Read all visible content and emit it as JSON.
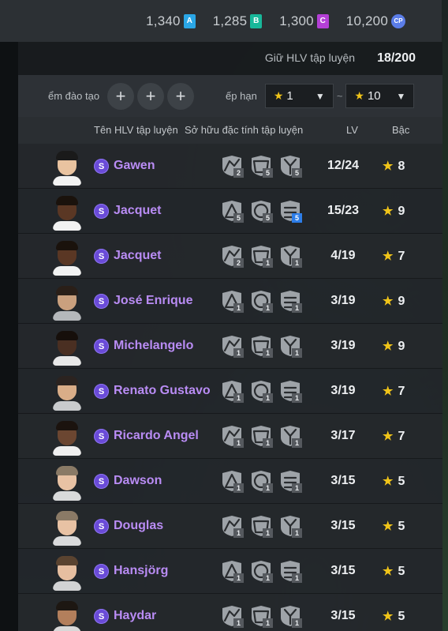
{
  "currencies": [
    {
      "value": "1,340",
      "icon": "A",
      "color": "#2aa6e6",
      "icon_name": "a-currency-icon"
    },
    {
      "value": "1,285",
      "icon": "B",
      "color": "#18b89a",
      "icon_name": "b-currency-icon"
    },
    {
      "value": "1,300",
      "icon": "C",
      "color": "#b43fd6",
      "icon_name": "c-currency-icon"
    },
    {
      "value": "10,200",
      "icon": "CP",
      "color": "#5b7de8",
      "icon_name": "cp-currency-icon"
    }
  ],
  "capacity": {
    "label": "Giữ HLV tập luyện",
    "value": "18/200"
  },
  "filters": {
    "training_label": "ểm đào tạo",
    "plus": "+",
    "rank_label": "ếp hạn",
    "rank_min": "1",
    "rank_max": "10",
    "tilde": "~",
    "star": "★",
    "chevron": "▼"
  },
  "columns": {
    "name": "Tên HLV tập luyện",
    "traits": "Sở hữu đặc tính tập luyện",
    "lv": "LV",
    "rank": "Bậc"
  },
  "badge_letter": "S",
  "rows": [
    {
      "name": "Gawen",
      "lv": "12/24",
      "rank": "8",
      "traits": [
        "2",
        "5",
        "5"
      ],
      "skin": "#e9c3a0",
      "hair": "#1a1a1a",
      "shirt": "#f2f2f2"
    },
    {
      "name": "Jacquet",
      "lv": "15/23",
      "rank": "9",
      "traits": [
        "5",
        "5",
        "5"
      ],
      "skin": "#5a3724",
      "hair": "#1a120c",
      "shirt": "#f2f2f2"
    },
    {
      "name": "Jacquet",
      "lv": "4/19",
      "rank": "7",
      "traits": [
        "2",
        "1",
        "1"
      ],
      "skin": "#5a3724",
      "hair": "#1a120c",
      "shirt": "#f2f2f2"
    },
    {
      "name": "José Enrique",
      "lv": "3/19",
      "rank": "9",
      "traits": [
        "1",
        "1",
        "1"
      ],
      "skin": "#caa07e",
      "hair": "#2a1f18",
      "shirt": "#b5b8bb"
    },
    {
      "name": "Michelangelo",
      "lv": "3/19",
      "rank": "9",
      "traits": [
        "1",
        "1",
        "1"
      ],
      "skin": "#4a2f22",
      "hair": "#160f0b",
      "shirt": "#e8e8e8"
    },
    {
      "name": "Renato Gustavo",
      "lv": "3/19",
      "rank": "7",
      "traits": [
        "1",
        "1",
        "1"
      ],
      "skin": "#d9ad88",
      "hair": "#2b2320",
      "shirt": "#c9cbcd"
    },
    {
      "name": "Ricardo Angel",
      "lv": "3/17",
      "rank": "7",
      "traits": [
        "1",
        "1",
        "1"
      ],
      "skin": "#6b4631",
      "hair": "#1b130e",
      "shirt": "#efefef"
    },
    {
      "name": "Dawson",
      "lv": "3/15",
      "rank": "5",
      "traits": [
        "1",
        "1",
        "1"
      ],
      "skin": "#e8c2a4",
      "hair": "#8a7a66",
      "shirt": "#d9dadb"
    },
    {
      "name": "Douglas",
      "lv": "3/15",
      "rank": "5",
      "traits": [
        "1",
        "1",
        "1"
      ],
      "skin": "#e8c2a4",
      "hair": "#8a7a66",
      "shirt": "#d9dadb"
    },
    {
      "name": "Hansjörg",
      "lv": "3/15",
      "rank": "5",
      "traits": [
        "1",
        "1",
        "1"
      ],
      "skin": "#e6bea0",
      "hair": "#5a4330",
      "shirt": "#d2d3d4"
    },
    {
      "name": "Haydar",
      "lv": "3/15",
      "rank": "5",
      "traits": [
        "1",
        "1",
        "1"
      ],
      "skin": "#b37f5c",
      "hair": "#1d1712",
      "shirt": "#d8d8d8"
    }
  ],
  "blue_trait": {
    "row": 1,
    "index": 2
  },
  "icons": [
    "a-currency-icon",
    "b-currency-icon",
    "c-currency-icon",
    "cp-currency-icon",
    "add-icon",
    "star-icon",
    "chevron-down-icon",
    "trait-icon",
    "grade-s-icon",
    "coach-avatar"
  ]
}
